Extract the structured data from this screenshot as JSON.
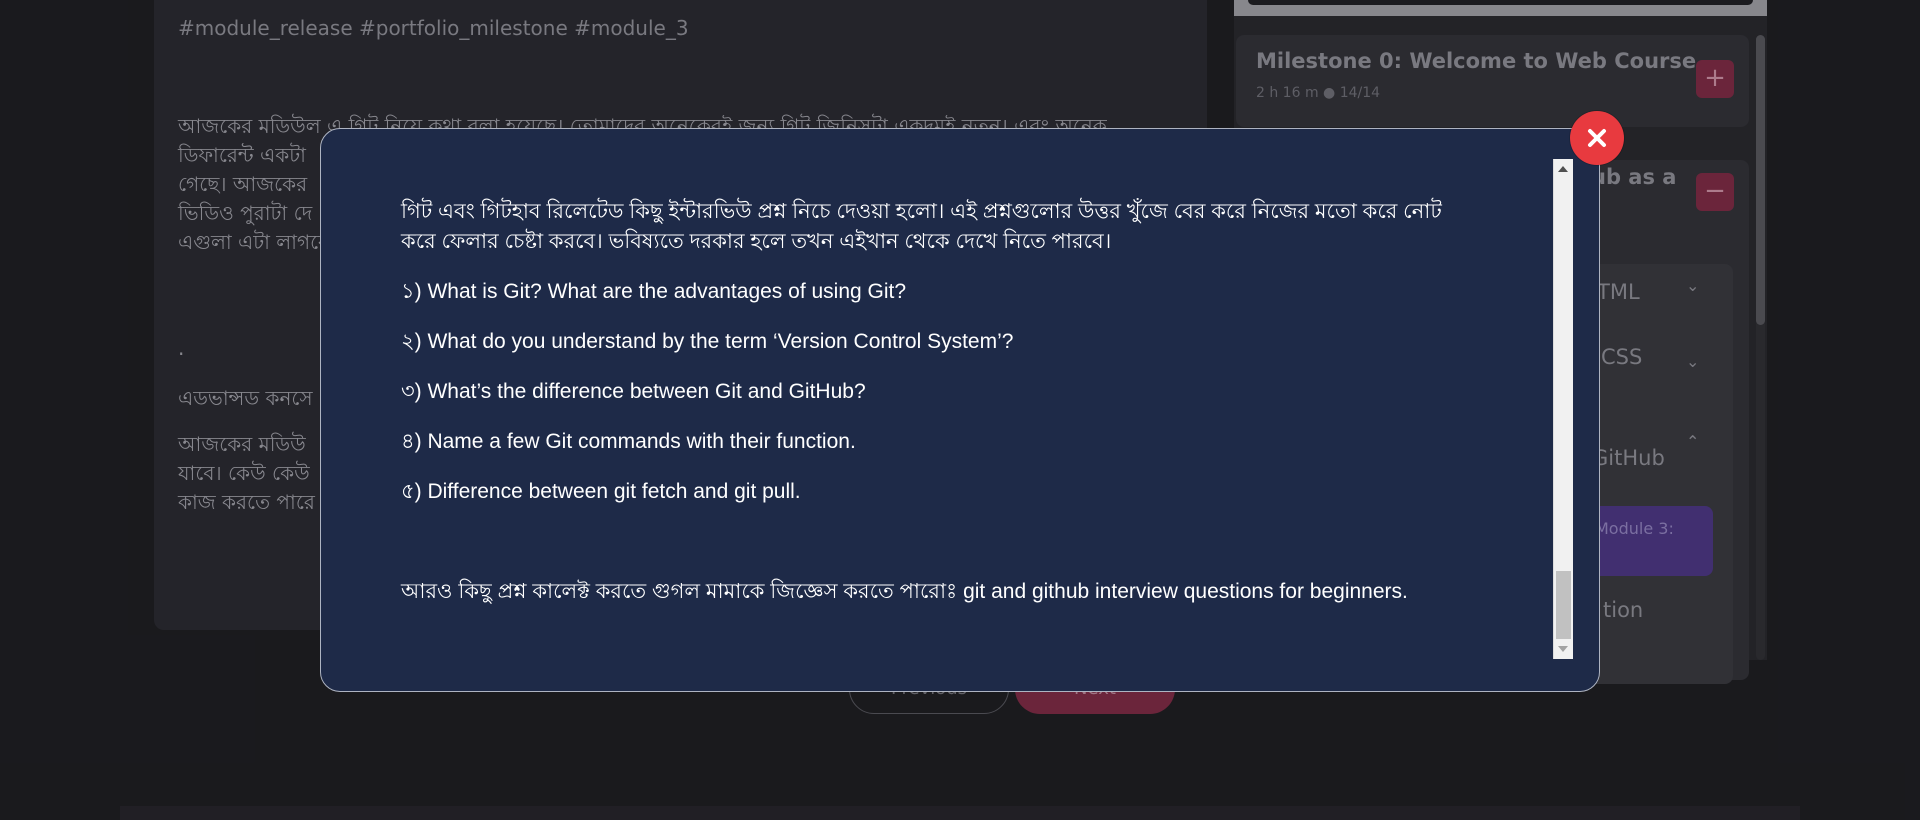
{
  "background": {
    "tags": "#module_release #portfolio_milestone #module_3",
    "paragraph1": "আজকের মডিউল এ গিট নিয়ে কথা বলা হয়েছে। তোমাদের অনেকেরই জন্য গিট জিনিসটা একদমই নতুন। এবং অনেক\nডিফারেন্ট একটা\nগেছে। আজকের\nভিডিও পুরাটা দে\nএগুলা এটা লাগবে",
    "dot": ".",
    "paragraph2": "এডভান্সড কনসে",
    "paragraph3": "আজকের মডিউ\nযাবে। কেউ কেউ\nকাজ করতে পারে",
    "prev_label": "Previous",
    "next_label": "Next"
  },
  "sidebar": {
    "milestone0": {
      "title": "Milestone 0: Welcome to Web Course",
      "meta": "2 h 16 m ●  14/14",
      "toggle": "+"
    },
    "milestone1": {
      "title_fragment": "ub as a",
      "toggle": "−"
    },
    "modules": [
      {
        "label": "TML"
      },
      {
        "label": "CSS"
      },
      {
        "label": "GitHub"
      },
      {
        "label": "tion"
      }
    ],
    "active_module": "Module 3:"
  },
  "modal": {
    "intro": "গিট এবং গিটহাব রিলেটেড কিছু ইন্টারভিউ প্রশ্ন নিচে দেওয়া হলো। এই প্রশ্নগুলোর উত্তর খুঁজে বের করে নিজের মতো করে নোট করে ফেলার চেষ্টা করবে। ভবিষ্যতে দরকার হলে তখন এইখান থেকে দেখে নিতে পারবে।",
    "questions": [
      "১) What is Git? What are the advantages of using Git?",
      "২) What do you understand by the term ‘Version Control System’?",
      "৩) What’s the difference between Git and GitHub?",
      "৪) Name a few Git commands with their function.",
      "৫) Difference between git fetch and git pull."
    ],
    "more": "আরও কিছু প্রশ্ন কালেক্ট করতে গুগল মামাকে জিজ্ঞেস করতে পারোঃ git and github interview questions for beginners.",
    "close_icon": "close-x-icon",
    "accent_color": "#e83a3f",
    "background_color": "#1e2a48"
  }
}
